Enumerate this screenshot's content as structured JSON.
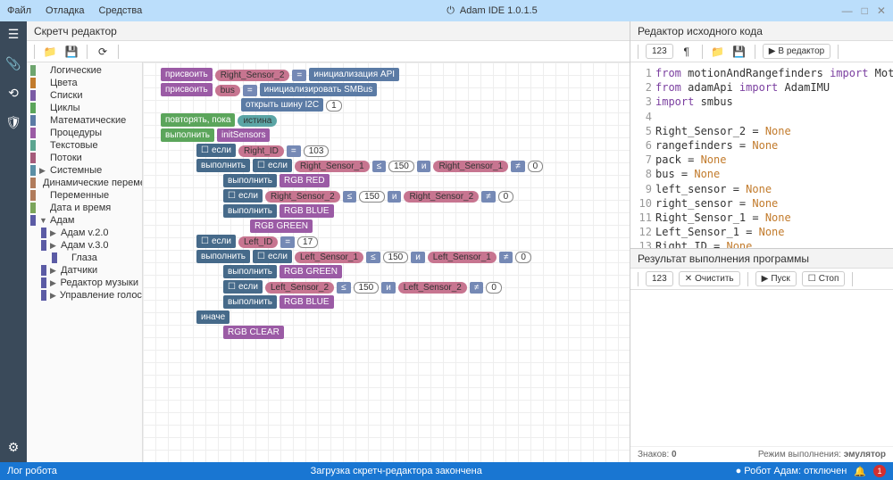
{
  "menu": {
    "file": "Файл",
    "debug": "Отладка",
    "tools": "Средства"
  },
  "app_title": "Adam IDE 1.0.1.5",
  "sidebar": {
    "icons": [
      "menu",
      "attach",
      "debug",
      "security",
      "settings"
    ]
  },
  "scratch": {
    "title": "Скретч редактор",
    "categories": [
      {
        "label": "Логические",
        "color": "#6ea56e"
      },
      {
        "label": "Цвета",
        "color": "#c27b2c"
      },
      {
        "label": "Списки",
        "color": "#7b5ba5"
      },
      {
        "label": "Циклы",
        "color": "#5ba55b"
      },
      {
        "label": "Математические",
        "color": "#5b7ba5"
      },
      {
        "label": "Процедуры",
        "color": "#9b5ba5"
      },
      {
        "label": "Текстовые",
        "color": "#5ba590"
      },
      {
        "label": "Потоки",
        "color": "#a55b7b"
      },
      {
        "label": "Системные",
        "color": "#5b8fa5",
        "arrow": true
      },
      {
        "label": "Динамические переменные",
        "color": "#b07b5b"
      },
      {
        "label": "Переменные",
        "color": "#b07b5b"
      },
      {
        "label": "Дата и время",
        "color": "#7ba55b"
      },
      {
        "label": "Адам",
        "color": "#5b5ba5",
        "arrow": true,
        "open": true
      },
      {
        "label": "Адам v.2.0",
        "color": "#5b5ba5",
        "arrow": true,
        "indent": 1
      },
      {
        "label": "Адам v.3.0",
        "color": "#5b5ba5",
        "arrow": true,
        "indent": 1
      },
      {
        "label": "Глаза",
        "color": "#5b5ba5",
        "indent": 2
      },
      {
        "label": "Датчики",
        "color": "#5b5ba5",
        "arrow": true,
        "indent": 1
      },
      {
        "label": "Редактор музыки",
        "color": "#5b5ba5",
        "arrow": true,
        "indent": 1
      },
      {
        "label": "Управление голосом",
        "color": "#5b5ba5",
        "arrow": true,
        "indent": 1
      }
    ],
    "blocks": {
      "assign": "присвоить",
      "bus": "bus",
      "right_sensor_2": "Right_Sensor_2",
      "init_api": "инициализация API",
      "init_smbus": "инициализировать SMBus",
      "open_i2c": "открыть шину I2C",
      "repeat_while": "повторять, пока",
      "true": "истина",
      "execute": "выполнить",
      "init_sensors": "initSensors",
      "if": "если",
      "else": "иначе",
      "right_id": "Right_ID",
      "left_id": "Left_ID",
      "right_sensor_1": "Right_Sensor_1",
      "left_sensor_1": "Left_Sensor_1",
      "left_sensor_2": "Left_Sensor_2",
      "rgb_red": "RGB RED",
      "rgb_blue": "RGB BLUE",
      "rgb_green": "RGB GREEN",
      "rgb_clear": "RGB CLEAR",
      "v103": "103",
      "v150": "150",
      "v17": "17",
      "v0": "0",
      "eq": "=",
      "le": "≤",
      "ne": "≠",
      "and": "и",
      "one": "1"
    }
  },
  "code_editor": {
    "title": "Редактор исходного кода",
    "to_editor": "В редактор",
    "lines": [
      [
        {
          "t": "from ",
          "c": "kw"
        },
        {
          "t": "motionAndRangefinders "
        },
        {
          "t": "import ",
          "c": "kw"
        },
        {
          "t": "MotionA"
        }
      ],
      [
        {
          "t": "from ",
          "c": "kw"
        },
        {
          "t": "adamApi "
        },
        {
          "t": "import ",
          "c": "kw"
        },
        {
          "t": "AdamIMU"
        }
      ],
      [
        {
          "t": "import ",
          "c": "kw"
        },
        {
          "t": "smbus"
        }
      ],
      [
        {
          "t": ""
        }
      ],
      [
        {
          "t": "Right_Sensor_2 = "
        },
        {
          "t": "None",
          "c": "none"
        }
      ],
      [
        {
          "t": "rangefinders = "
        },
        {
          "t": "None",
          "c": "none"
        }
      ],
      [
        {
          "t": "pack = "
        },
        {
          "t": "None",
          "c": "none"
        }
      ],
      [
        {
          "t": "bus = "
        },
        {
          "t": "None",
          "c": "none"
        }
      ],
      [
        {
          "t": "left_sensor = "
        },
        {
          "t": "None",
          "c": "none"
        }
      ],
      [
        {
          "t": "right_sensor = "
        },
        {
          "t": "None",
          "c": "none"
        }
      ],
      [
        {
          "t": "Right_Sensor_1 = "
        },
        {
          "t": "None",
          "c": "none"
        }
      ],
      [
        {
          "t": "Left_Sensor_1 = "
        },
        {
          "t": "None",
          "c": "none"
        }
      ],
      [
        {
          "t": "Right_ID = "
        },
        {
          "t": "None",
          "c": "none"
        }
      ]
    ]
  },
  "result": {
    "title": "Результат выполнения программы",
    "clear": "Очистить",
    "start": "Пуск",
    "stop": "Стоп"
  },
  "status": {
    "chars": "Знаков:",
    "chars_n": "0",
    "mode": "Режим выполнения:",
    "mode_v": "эмулятор"
  },
  "bottombar": {
    "log": "Лог робота",
    "loaded": "Загрузка скретч-редактора закончена",
    "robot": "Робот Адам: отключен",
    "badge": "1"
  }
}
